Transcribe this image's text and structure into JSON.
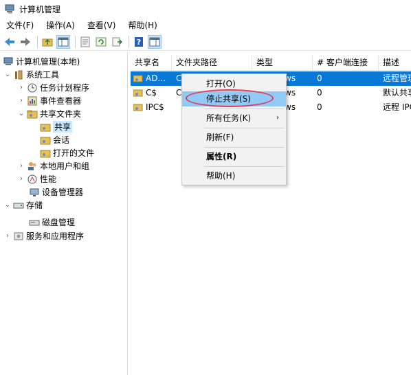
{
  "window": {
    "title": "计算机管理"
  },
  "menubar": [
    "文件(F)",
    "操作(A)",
    "查看(V)",
    "帮助(H)"
  ],
  "toolbar": [
    "back-icon",
    "forward-icon",
    "up-folder-icon",
    "show-tree-icon",
    "properties-icon",
    "refresh-icon",
    "export-icon",
    "help-icon",
    "show-action-pane-icon"
  ],
  "tree": {
    "root": "计算机管理(本地)",
    "system_tools": "系统工具",
    "task_scheduler": "任务计划程序",
    "event_viewer": "事件查看器",
    "shared_folders": "共享文件夹",
    "shares": "共享",
    "sessions": "会话",
    "open_files": "打开的文件",
    "local_users": "本地用户和组",
    "performance": "性能",
    "device_manager": "设备管理器",
    "storage": "存储",
    "disk_management": "磁盘管理",
    "services_apps": "服务和应用程序"
  },
  "columns": [
    "共享名",
    "文件夹路径",
    "类型",
    "# 客户端连接",
    "描述"
  ],
  "rows": [
    {
      "name": "AD...",
      "path": "C",
      "type": "ws",
      "clients": "0",
      "desc": "远程管理"
    },
    {
      "name": "C$",
      "path": "C",
      "type": "ws",
      "clients": "0",
      "desc": "默认共享"
    },
    {
      "name": "IPC$",
      "path": "",
      "type": "ws",
      "clients": "0",
      "desc": "远程 IPC"
    }
  ],
  "context_menu": {
    "open": "打开(O)",
    "stop_sharing": "停止共享(S)",
    "all_tasks": "所有任务(K)",
    "refresh": "刷新(F)",
    "properties": "属性(R)",
    "help": "帮助(H)"
  },
  "colors": {
    "selection": "#0a78d7",
    "menu_highlight": "#91c9f7",
    "annotation": "#e23c55"
  }
}
